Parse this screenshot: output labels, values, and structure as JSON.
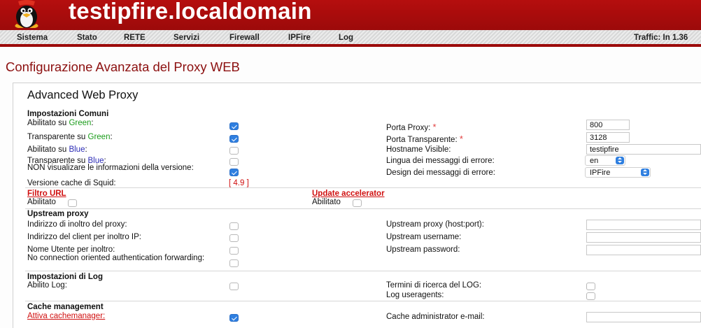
{
  "header": {
    "hostname": "testipfire.localdomain"
  },
  "nav": {
    "items": [
      "Sistema",
      "Stato",
      "RETE",
      "Servizi",
      "Firewall",
      "IPFire",
      "Log"
    ],
    "traffic": "Traffic: In 1.36"
  },
  "page_title": "Configurazione Avanzata del Proxy WEB",
  "panel_title": "Advanced Web Proxy",
  "common": {
    "heading": "Impostazioni Comuni",
    "enabled_prefix": "Abilitato su ",
    "transparent_prefix": "Transparente su ",
    "green": "Green",
    "blue": "Blue",
    "colon": ":",
    "no_version_info": "NON visualizare le informazioni della versione:",
    "squid_version_label": "Versione cache di Squid:",
    "squid_version": "[ 4.9 ]",
    "proxy_port_label": "Porta Proxy:",
    "proxy_port": "800",
    "transparent_port_label": "Porta Transparente:",
    "transparent_port": "3128",
    "visible_hostname_label": "Hostname Visible:",
    "visible_hostname": "testipfire",
    "error_language_label": "Lingua dei messaggi di errore:",
    "error_language": "en",
    "error_design_label": "Design dei messaggi di errore:",
    "error_design": "IPFire",
    "required_mark": "*"
  },
  "url_filter": {
    "heading": "Filtro URL",
    "enabled_label": "Abilitato"
  },
  "update_accelerator": {
    "heading": "Update accelerator",
    "enabled_label": "Abilitato"
  },
  "upstream": {
    "heading": "Upstream proxy",
    "forward_proxy_address": "Indirizzo di inoltro del proxy:",
    "forward_client_ip": "Indirizzo del client per inoltro IP:",
    "forward_username": "Nome Utente per inoltro:",
    "no_conn_auth_forwarding": "No connection oriented authentication forwarding:",
    "upstream_proxy_label": "Upstream proxy (host:port):",
    "upstream_username_label": "Upstream username:",
    "upstream_password_label": "Upstream password:"
  },
  "log": {
    "heading": "Impostazioni di Log",
    "enable_log": "Abilito Log:",
    "search_terms": "Termini di ricerca del LOG:",
    "log_useragents": "Log useragents:"
  },
  "cache": {
    "heading": "Cache management",
    "activate_cachemanager": "Attiva cachemanager:",
    "admin_email_label": "Cache administrator e-mail:"
  }
}
